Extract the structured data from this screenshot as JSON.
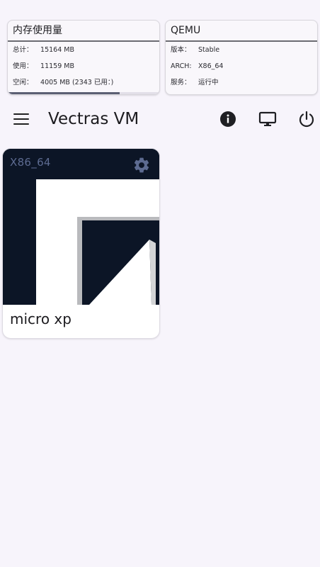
{
  "memory": {
    "title": "内存使用量",
    "total_label": "总计：",
    "total_value": "15164 MB",
    "used_label": "使用：",
    "used_value": "11159 MB",
    "free_label": "空闲：",
    "free_value": "4005 MB (2343 已用：)",
    "usage_fraction": 0.74
  },
  "qemu": {
    "title": "QEMU",
    "version_label": "版本：",
    "version_value": "Stable",
    "arch_label": "ARCH:",
    "arch_value": "X86_64",
    "service_label": "服务：",
    "service_value": "运行中"
  },
  "appbar": {
    "title": "Vectras VM",
    "icons": [
      "menu-icon",
      "info-icon",
      "monitor-icon",
      "power-icon"
    ]
  },
  "vm": {
    "arch": "X86_64",
    "name": "micro xp",
    "icon": "settings-gear-icon"
  },
  "colors": {
    "background": "#f7f4fb",
    "thumbnail_bg": "#0c1526",
    "arch_text": "#5d6b91",
    "gear": "#5d6b91"
  }
}
